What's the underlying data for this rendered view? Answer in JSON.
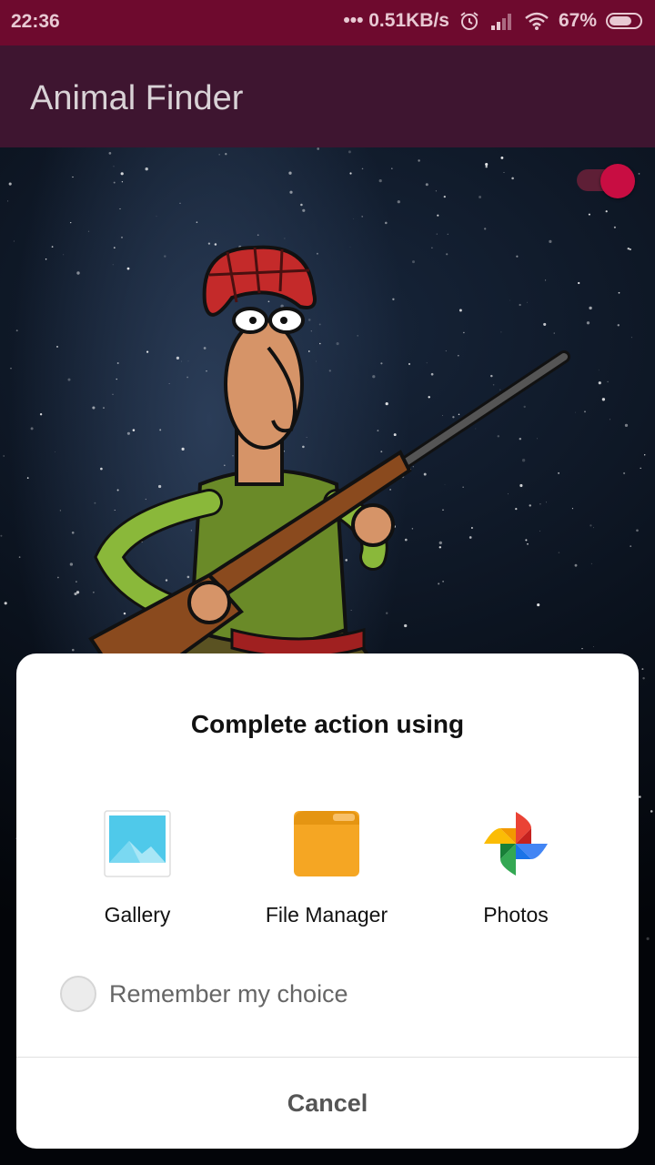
{
  "status_bar": {
    "time": "22:36",
    "network_speed": "••• 0.51KB/s",
    "battery_percent": "67%",
    "icons": [
      "alarm-icon",
      "signal-icon",
      "wifi-icon",
      "battery-icon"
    ]
  },
  "app_bar": {
    "title": "Animal Finder"
  },
  "toggle": {
    "state": "on",
    "color": "#c80d42"
  },
  "dialog": {
    "title": "Complete action using",
    "apps": [
      {
        "label": "Gallery",
        "icon": "gallery-icon"
      },
      {
        "label": "File Manager",
        "icon": "file-manager-icon"
      },
      {
        "label": "Photos",
        "icon": "photos-icon"
      }
    ],
    "remember_label": "Remember my choice",
    "remember_checked": false,
    "cancel_label": "Cancel"
  },
  "colors": {
    "status_bar": "#6e0a2e",
    "app_bar": "#3e1530",
    "accent": "#c80d42"
  }
}
